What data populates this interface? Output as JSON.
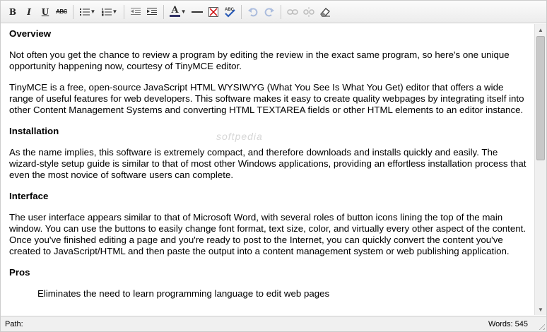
{
  "toolbar": {
    "bold": "B",
    "italic": "I",
    "underline": "U",
    "strike": "ABC",
    "font_color": "A",
    "spellcheck": "ABC"
  },
  "content": {
    "sections": [
      {
        "heading": "Overview",
        "paragraphs": [
          "Not often you get the chance to review a program by editing the review in the exact same program, so here's one unique opportunity happening now, courtesy of TinyMCE editor.",
          "TinyMCE is a free, open-source JavaScript HTML WYSIWYG (What You See Is What You Get) editor that offers a wide range of useful features for web developers. This software makes it easy to create quality webpages by integrating itself into other Content Management Systems and converting HTML TEXTAREA fields or other HTML elements to an editor instance."
        ]
      },
      {
        "heading": "Installation",
        "paragraphs": [
          "As the name implies, this software is extremely compact, and therefore downloads and installs quickly and easily. The wizard-style setup guide is similar to that of most other Windows applications, providing an effortless installation process that even the most novice of software users can complete."
        ]
      },
      {
        "heading": "Interface",
        "paragraphs": [
          "The user interface appears similar to that of Microsoft Word, with several roles of button icons lining the top of the main window. You can use the buttons to easily change font format, text size, color, and virtually every other aspect of the content. Once you've finished editing a page and you're ready to post to the Internet, you can quickly convert the content you've created to JavaScript/HTML and then paste the output into a content management system or web publishing application."
        ]
      },
      {
        "heading": "Pros",
        "paragraphs": []
      }
    ],
    "cut_off_line": "Eliminates the need to learn programming language to edit web pages"
  },
  "status": {
    "path_label": "Path:",
    "words_label": "Words: 545"
  }
}
